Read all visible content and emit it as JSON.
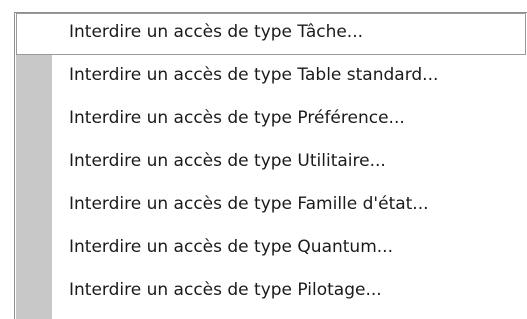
{
  "menu": {
    "items": [
      {
        "label": "Interdire un accès de type Tâche..."
      },
      {
        "label": "Interdire un accès de type Table standard..."
      },
      {
        "label": "Interdire un accès de type Préférence..."
      },
      {
        "label": "Interdire un accès de type Utilitaire..."
      },
      {
        "label": "Interdire un accès de type Famille d'état..."
      },
      {
        "label": "Interdire un accès de type Quantum..."
      },
      {
        "label": "Interdire un accès de type Pilotage..."
      }
    ]
  }
}
